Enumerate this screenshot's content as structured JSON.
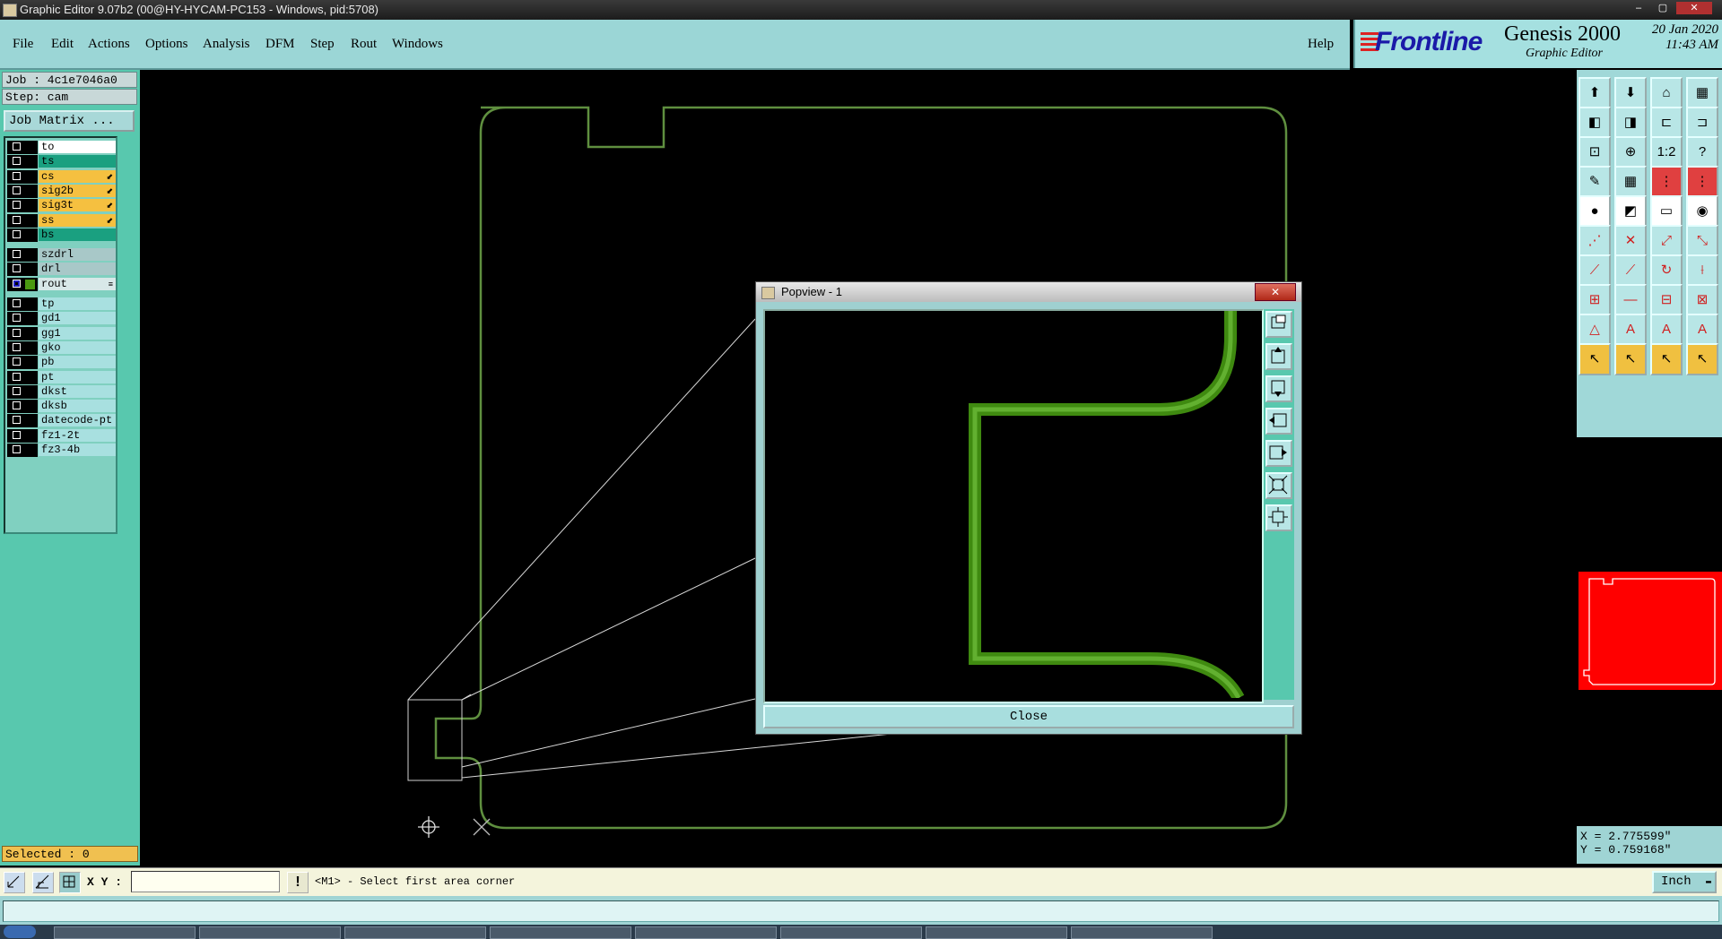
{
  "window": {
    "title": "Graphic Editor 9.07b2 (00@HY-HYCAM-PC153 - Windows, pid:5708)",
    "controls": [
      "–",
      "▢",
      "✕"
    ]
  },
  "menu": {
    "items": [
      "File",
      "Edit",
      "Actions",
      "Options",
      "Analysis",
      "DFM",
      "Step",
      "Rout",
      "Windows"
    ],
    "help": "Help"
  },
  "brand": {
    "logo": "Frontline",
    "product": "Genesis 2000",
    "subtitle": "Graphic Editor",
    "date": "20 Jan 2020",
    "time": "11:43 AM"
  },
  "left_panel": {
    "job": "Job : 4c1e7046a0",
    "step": "Step: cam",
    "job_matrix": "Job Matrix ...",
    "layers": [
      {
        "name": "to",
        "color": "#ffffff",
        "arrow": ""
      },
      {
        "name": "ts",
        "color": "#1aa080",
        "arrow": ""
      },
      {
        "name": "cs",
        "color": "#f5c040",
        "arrow": "⬋"
      },
      {
        "name": "sig2b",
        "color": "#f5c040",
        "arrow": "⬋"
      },
      {
        "name": "sig3t",
        "color": "#f5c040",
        "arrow": "⬋"
      },
      {
        "name": "ss",
        "color": "#f5c040",
        "arrow": "⬋"
      },
      {
        "name": "bs",
        "color": "#1aa080",
        "arrow": ""
      },
      {
        "name": "szdrl",
        "color": "#a8c8c8",
        "arrow": ""
      },
      {
        "name": "drl",
        "color": "#a8c8c8",
        "arrow": ""
      },
      {
        "name": "rout",
        "color": "#d8e8e8",
        "arrow": "≡",
        "active": true
      },
      {
        "name": "tp",
        "color": "#a8e0e0",
        "arrow": ""
      },
      {
        "name": "gd1",
        "color": "#a8e0e0",
        "arrow": ""
      },
      {
        "name": "gg1",
        "color": "#a8e0e0",
        "arrow": ""
      },
      {
        "name": "gko",
        "color": "#a8e0e0",
        "arrow": ""
      },
      {
        "name": "pb",
        "color": "#a8e0e0",
        "arrow": ""
      },
      {
        "name": "pt",
        "color": "#a8e0e0",
        "arrow": ""
      },
      {
        "name": "dkst",
        "color": "#a8e0e0",
        "arrow": ""
      },
      {
        "name": "dksb",
        "color": "#a8e0e0",
        "arrow": ""
      },
      {
        "name": "datecode-pt",
        "color": "#a8e0e0",
        "arrow": ""
      },
      {
        "name": "fz1-2t",
        "color": "#a8e0e0",
        "arrow": ""
      },
      {
        "name": "fz3-4b",
        "color": "#a8e0e0",
        "arrow": ""
      }
    ],
    "selected": "Selected : 0"
  },
  "popview": {
    "title": "Popview - 1",
    "close_label": "Close"
  },
  "coordinates": {
    "x": "X = 2.775599\"",
    "y": "Y = 0.759168\""
  },
  "status": {
    "xy_label": "X Y :",
    "xy_value": "",
    "message": "<M1> - Select first area corner",
    "units": "Inch"
  },
  "colors": {
    "profile": "#5a8a3a",
    "rout_layer": "#4a9a10",
    "minimap_fill": "#ff0000",
    "panel_teal": "#58c8ae"
  }
}
